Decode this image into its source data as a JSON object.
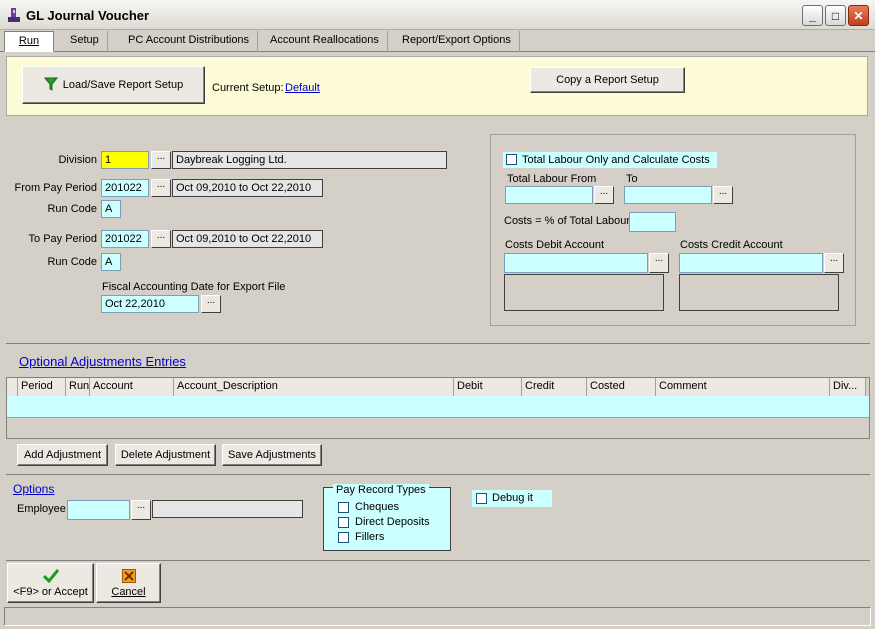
{
  "window": {
    "title": "GL Journal Voucher"
  },
  "tabs": [
    "Run",
    "Setup",
    "PC Account Distributions",
    "Account Reallocations",
    "Report/Export Options"
  ],
  "setup": {
    "load_save_label": "Load/Save Report Setup",
    "current_label": "Current Setup:",
    "current_value": "Default",
    "copy_label": "Copy a Report Setup"
  },
  "form": {
    "division_label": "Division",
    "division_value": "1",
    "division_name": "Daybreak Logging Ltd.",
    "from_period_label": "From Pay Period",
    "from_period_value": "201022",
    "from_period_range": "Oct 09,2010 to Oct 22,2010",
    "from_run_label": "Run Code",
    "from_run_value": "A",
    "to_period_label": "To Pay Period",
    "to_period_value": "201022",
    "to_period_range": "Oct 09,2010 to Oct 22,2010",
    "to_run_label": "Run Code",
    "to_run_value": "A",
    "fiscal_label": "Fiscal Accounting Date for Export File",
    "fiscal_value": "Oct 22,2010"
  },
  "labour": {
    "total_only_label": "Total Labour Only and Calculate Costs",
    "from_label": "Total Labour From",
    "to_label": "To",
    "costs_pct_label": "Costs = % of Total Labour",
    "debit_label": "Costs Debit Account",
    "credit_label": "Costs Credit Account"
  },
  "adjustments": {
    "title": "Optional Adjustments Entries",
    "columns": [
      "Period",
      "Run",
      "Account",
      "Account_Description",
      "Debit",
      "Credit",
      "Costed",
      "Comment",
      "Div..."
    ],
    "add_label": "Add Adjustment",
    "delete_label": "Delete Adjustment",
    "save_label": "Save Adjustments"
  },
  "options": {
    "title": "Options",
    "employee_label": "Employee",
    "pay_types_title": "Pay Record Types",
    "pay_types": [
      "Cheques",
      "Direct Deposits",
      "Fillers"
    ],
    "debug_label": "Debug it"
  },
  "actions": {
    "accept_label": "<F9> or Accept",
    "cancel_label": "Cancel"
  },
  "icons": {
    "app": "app-icon",
    "filter": "filter-icon",
    "accept": "checkmark-icon",
    "cancel": "cancel-icon"
  },
  "colors": {
    "field_bg": "#ccffff",
    "highlight": "#ffff00",
    "band": "#fdfcd6",
    "link": "#0000cc"
  }
}
